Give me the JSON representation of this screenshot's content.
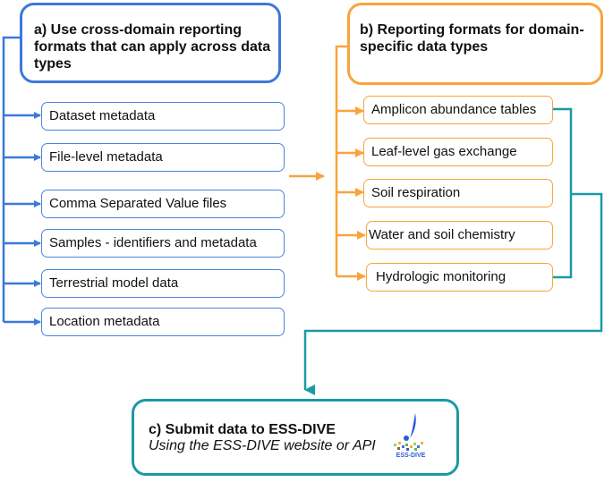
{
  "colors": {
    "cross_domain": "#3d78d8",
    "domain_specific": "#f9a43b",
    "submit": "#1a9aa5"
  },
  "section_a": {
    "title": "a) Use cross-domain reporting formats that can apply across data types",
    "items": [
      "Dataset metadata",
      "File-level metadata",
      "Comma Separated Value files",
      "Samples - identifiers and metadata",
      "Terrestrial model data",
      "Location metadata"
    ]
  },
  "section_b": {
    "title": "b) Reporting formats for domain-specific data types",
    "items": [
      "Amplicon abundance tables",
      "Leaf-level gas exchange",
      "Soil respiration",
      "Water and soil chemistry",
      "Hydrologic monitoring"
    ]
  },
  "section_c": {
    "title": "c) Submit data to ESS-DIVE",
    "subtitle": "Using the ESS-DIVE website or API",
    "logo_text": "ESS-DIVE"
  }
}
